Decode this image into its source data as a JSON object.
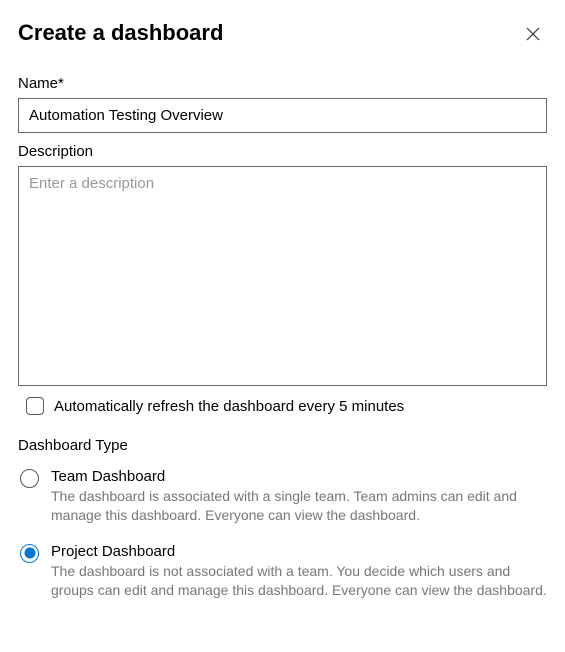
{
  "header": {
    "title": "Create a dashboard"
  },
  "name": {
    "label": "Name*",
    "value": "Automation Testing Overview"
  },
  "description": {
    "label": "Description",
    "placeholder": "Enter a description",
    "value": ""
  },
  "autorefresh": {
    "label": "Automatically refresh the dashboard every 5 minutes"
  },
  "dashboardType": {
    "label": "Dashboard Type",
    "options": {
      "team": {
        "title": "Team Dashboard",
        "desc": "The dashboard is associated with a single team. Team admins can edit and manage this dashboard. Everyone can view the dashboard."
      },
      "project": {
        "title": "Project Dashboard",
        "desc": "The dashboard is not associated with a team. You decide which users and groups can edit and manage this dashboard. Everyone can view the dashboard."
      }
    }
  }
}
